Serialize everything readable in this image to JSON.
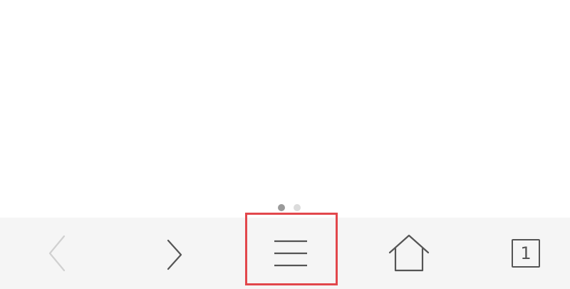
{
  "page_indicator": {
    "total_pages": 2,
    "active_page": 1
  },
  "toolbar": {
    "back": {
      "icon": "chevron-left-icon",
      "enabled": false
    },
    "forward": {
      "icon": "chevron-right-icon",
      "enabled": true
    },
    "menu": {
      "icon": "hamburger-menu-icon",
      "highlighted": true
    },
    "home": {
      "icon": "home-icon"
    },
    "tabs": {
      "icon": "tabs-icon",
      "count": "1"
    }
  },
  "colors": {
    "toolbar_bg": "#f5f5f5",
    "icon_active": "#555555",
    "icon_disabled": "#d0d0d0",
    "highlight": "#e2474c"
  }
}
